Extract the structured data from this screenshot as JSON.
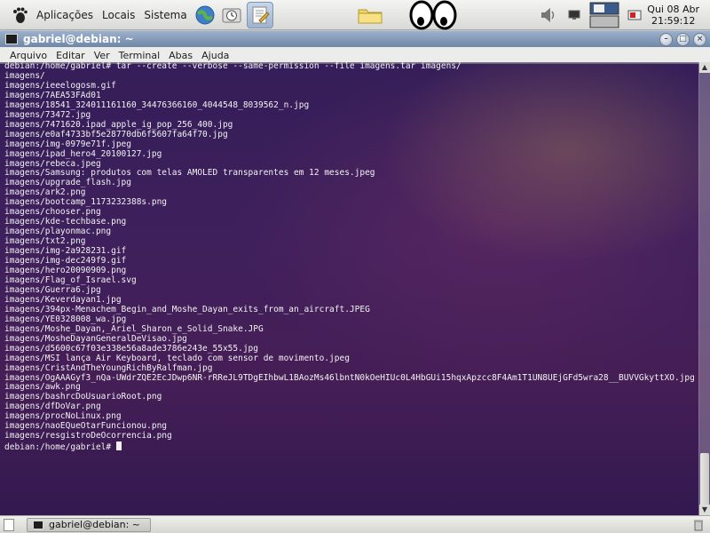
{
  "panel": {
    "menus": [
      "Aplicações",
      "Locais",
      "Sistema"
    ],
    "clock": {
      "day": "Qui 08 Abr",
      "time": "21:59:12"
    }
  },
  "window": {
    "title": "gabriel@debian: ~",
    "menus": [
      "Arquivo",
      "Editar",
      "Ver",
      "Terminal",
      "Abas",
      "Ajuda"
    ]
  },
  "terminal": {
    "lines": [
      "debian:/home/gabriel# tar --create --verbose --same-permission --file imagens.tar imagens/",
      "imagens/",
      "imagens/ieeelogosm.gif",
      "imagens/7AEA53FAd01",
      "imagens/18541_324011161160_34476366160_4044548_8039562_n.jpg",
      "imagens/73472.jpg",
      "imagens/7471620.ipad_apple_ig_pop_256_400.jpg",
      "imagens/e0af4733bf5e28770db6f5607fa64f70.jpg",
      "imagens/img-0979e71f.jpeg",
      "imagens/ipad_hero4_20100127.jpg",
      "imagens/rebeca.jpeg",
      "imagens/Samsung: produtos com telas AMOLED transparentes em 12 meses.jpeg",
      "imagens/upgrade_flash.jpg",
      "imagens/ark2.png",
      "imagens/bootcamp_1173232388s.png",
      "imagens/chooser.png",
      "imagens/kde-techbase.png",
      "imagens/playonmac.png",
      "imagens/txt2.png",
      "imagens/img-2a928231.gif",
      "imagens/img-dec249f9.gif",
      "imagens/hero20090909.png",
      "imagens/Flag_of_Israel.svg",
      "imagens/Guerra6.jpg",
      "imagens/Keverdayan1.jpg",
      "imagens/394px-Menachem_Begin_and_Moshe_Dayan_exits_from_an_aircraft.JPEG",
      "imagens/YE0328008_wa.jpg",
      "imagens/Moshe_Dayan,_Ariel_Sharon_e_Solid_Snake.JPG",
      "imagens/MosheDayanGeneralDeVisao.jpg",
      "imagens/d5600c67f03e338e56a8ade3786e243e_55x55.jpg",
      "imagens/MSI lança Air Keyboard, teclado com sensor de movimento.jpeg",
      "imagens/CristAndTheYoungRichByRalfman.jpg",
      "imagens/OgAAAGyf3_nQa-UWdrZQE2EcJDwp6NR-rRReJL9TDgEIhbwL1BAozMs46lbntN0kOeHIUc0L4HbGUi15hqxApzcc8F4Am1T1UN8UEjGFd5wra28__BUVVGkyttXO.jpg",
      "imagens/awk.png",
      "imagens/bashrcDoUsuarioRoot.png",
      "imagens/dfDoVar.png",
      "imagens/procNoLinux.png",
      "imagens/naoEQueOtarFuncionou.png",
      "imagens/resgistroDeOcorrencia.png"
    ],
    "prompt": "debian:/home/gabriel# "
  },
  "taskbar": {
    "task_title": "gabriel@debian: ~"
  },
  "icons": {
    "panel": [
      "gnome-foot-icon",
      "web-browser-icon",
      "clock-app-icon",
      "text-editor-icon",
      "folder-icon",
      "xeyes-icon",
      "volume-icon",
      "network-icon",
      "workspace-switcher-icon",
      "logout-icon"
    ],
    "window": [
      "terminal-icon",
      "minimize-icon",
      "maximize-icon",
      "close-icon"
    ]
  },
  "colors": {
    "titlebar": "#7d94b3",
    "terminal_fg": "#f2f2f2"
  }
}
